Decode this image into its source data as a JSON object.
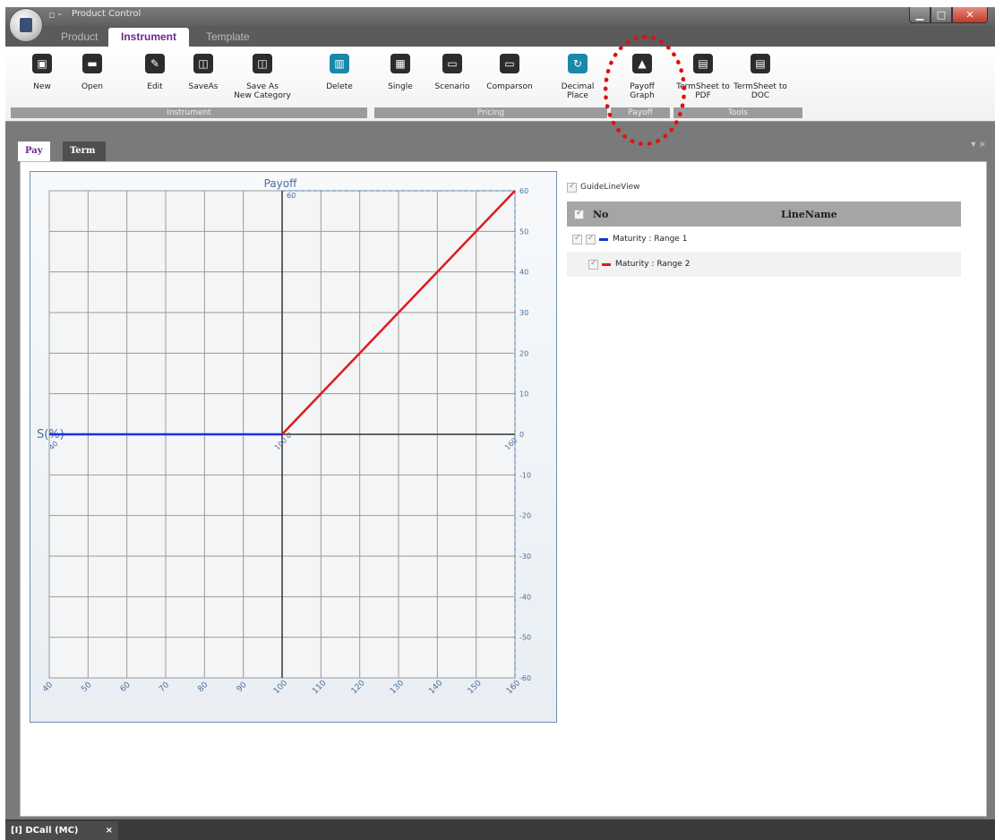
{
  "window": {
    "title": "Product Control",
    "qat": "▫ ╴"
  },
  "ribbon_tabs": [
    "Product",
    "Instrument",
    "Template"
  ],
  "ribbon_buttons": [
    {
      "label": "New",
      "icon": "new-icon",
      "glyph": "▣"
    },
    {
      "label": "Open",
      "icon": "folder-icon",
      "glyph": "▬"
    },
    {
      "label": "Edit",
      "icon": "edit-icon",
      "glyph": "✎"
    },
    {
      "label": "SaveAs",
      "icon": "save-icon",
      "glyph": "◫"
    },
    {
      "label": "Save As\nNew Category",
      "icon": "save-icon",
      "glyph": "◫"
    },
    {
      "label": "Delete",
      "icon": "trash-icon",
      "glyph": "▥"
    },
    {
      "label": "Single",
      "icon": "calculator-icon",
      "glyph": "▦"
    },
    {
      "label": "Scenario",
      "icon": "monitor-icon",
      "glyph": "▭"
    },
    {
      "label": "Comparson",
      "icon": "monitor-icon",
      "glyph": "▭"
    },
    {
      "label": "Decimal\nPlace",
      "icon": "refresh-icon",
      "glyph": "↻"
    },
    {
      "label": "Payoff\nGraph",
      "icon": "chart-icon",
      "glyph": "▲"
    },
    {
      "label": "TermSheet to\nPDF",
      "icon": "document-icon",
      "glyph": "▤"
    },
    {
      "label": "TermSheet to\nDOC",
      "icon": "document-icon",
      "glyph": "▤"
    }
  ],
  "ribbon_groups": [
    "Instrument",
    "Pricing",
    "Payoff",
    "Tools"
  ],
  "doc_tabs": [
    "Pay Off",
    "Term Sheet"
  ],
  "chart_data": {
    "type": "line",
    "title": "Payoff",
    "xlabel": "S(%)",
    "xlim": [
      40,
      160
    ],
    "ylim": [
      -60,
      60
    ],
    "x_ticks": [
      40,
      50,
      60,
      70,
      80,
      90,
      100,
      110,
      120,
      130,
      140,
      150,
      160
    ],
    "y_ticks": [
      60,
      50,
      40,
      30,
      20,
      10,
      0,
      -10,
      -20,
      -30,
      -40,
      -50,
      -60
    ],
    "center_labels": {
      "x_100": "100",
      "y_0": "0",
      "y_60": "60"
    },
    "grid": true,
    "series": [
      {
        "name": "Maturity : Range 1",
        "color": "#1a2fe0",
        "x": [
          40,
          100
        ],
        "y": [
          0,
          0
        ]
      },
      {
        "name": "Maturity : Range 2",
        "color": "#e01a1a",
        "x": [
          100,
          120,
          160
        ],
        "y": [
          0,
          20,
          60
        ]
      }
    ]
  },
  "legend": {
    "guide_label": "GuideLineView",
    "head_no": "No",
    "head_name": "LineName",
    "rows": [
      {
        "name": "Maturity : Range 1",
        "color": "#1a2fe0"
      },
      {
        "name": "Maturity : Range 2",
        "color": "#e01a1a"
      }
    ]
  },
  "status_tab": {
    "label": "[I] DCall (MC)",
    "close": "×"
  },
  "panel_ctrls": "▾ ×"
}
